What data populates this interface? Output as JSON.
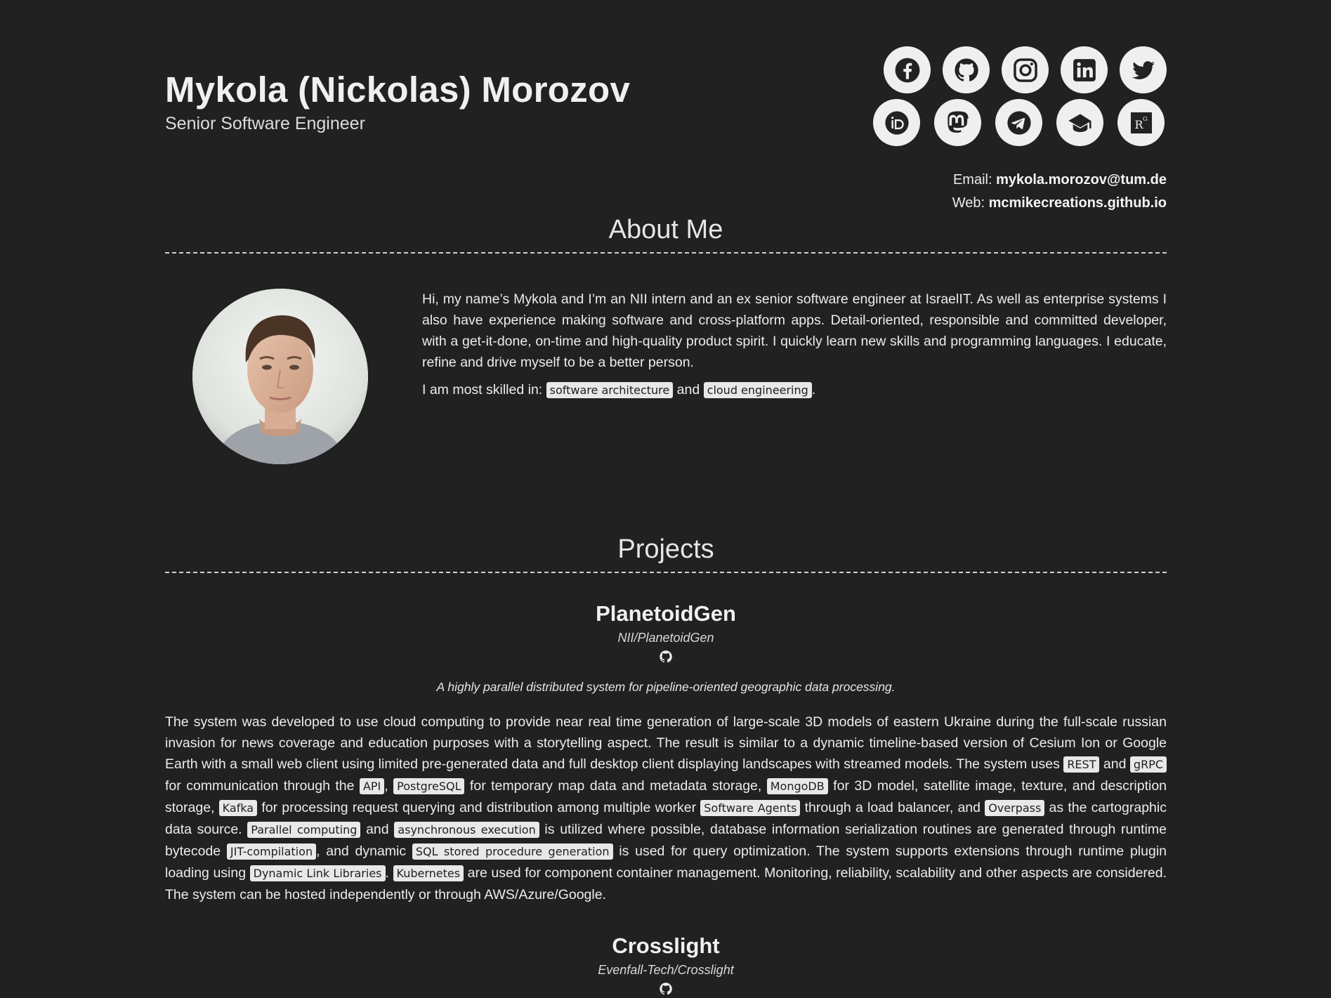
{
  "header": {
    "name": "Mykola (Nickolas) Morozov",
    "subtitle": "Senior Software Engineer",
    "socials_row1": [
      "facebook-icon",
      "github-icon",
      "instagram-icon",
      "linkedin-icon",
      "twitter-icon"
    ],
    "socials_row2": [
      "orcid-icon",
      "mastodon-icon",
      "telegram-icon",
      "scholar-icon",
      "researchgate-icon"
    ],
    "email_label": "Email:",
    "email": "mykola.morozov@tum.de",
    "web_label": "Web:",
    "web": "mcmikecreations.github.io"
  },
  "about": {
    "title": "About Me",
    "paragraph": "Hi, my name’s Mykola and I’m an NII intern and an ex senior software engineer at IsraelIT. As well as enterprise systems I also have experience making software and cross-platform apps. Detail-oriented, responsible and committed developer, with a get-it-done, on-time and high-quality product spirit. I quickly learn new skills and programming languages. I educate, refine and drive myself to be a better person.",
    "skills_intro": "I am most skilled in:",
    "skill1": "software architecture",
    "and": "and",
    "skill2": "cloud engineering",
    "period": "."
  },
  "projects": {
    "title": "Projects",
    "items": [
      {
        "name": "PlanetoidGen",
        "repo": "NII/PlanetoidGen",
        "tagline": "A highly parallel distributed system for pipeline-oriented geographic data processing.",
        "desc": {
          "t1": "The system was developed to use cloud computing to provide near real time generation of large-scale 3D models of eastern Ukraine during the full-scale russian invasion for news coverage and education purposes with a storytelling aspect. The result is similar to a dynamic timeline-based version of Cesium Ion or Google Earth with a small web client using limited pre-generated data and full desktop client displaying landscapes with streamed models. The system uses ",
          "k1": "REST",
          "t2": " and ",
          "k2": "gRPC",
          "t3": " for communication through the ",
          "k3": "API",
          "t4": ", ",
          "k4": "PostgreSQL",
          "t5": " for temporary map data and metadata storage, ",
          "k5": "MongoDB",
          "t6": " for 3D model, satellite image, texture, and description storage, ",
          "k6": "Kafka",
          "t7": " for processing request querying and distribution among multiple worker ",
          "k7": "Software Agents",
          "t8": " through a load balancer, and ",
          "k8": "Overpass",
          "t9": " as the cartographic data source. ",
          "k9": "Parallel computing",
          "t10": " and ",
          "k10": "asynchronous execution",
          "t11": " is utilized where possible, database information serialization routines are generated through runtime bytecode ",
          "k11": "JIT-compilation",
          "t12": ", and dynamic ",
          "k12": "SQL stored procedure generation",
          "t13": " is used for query optimization. The system supports extensions through runtime plugin loading using ",
          "k13": "Dynamic Link Libraries",
          "t14": ". ",
          "k14": "Kubernetes",
          "t15": " are used for component container management. Monitoring, reliability, scalability and other aspects are considered. The system can be hosted independently or through AWS/Azure/Google."
        }
      },
      {
        "name": "Crosslight",
        "repo": "Evenfall-Tech/Crosslight"
      }
    ]
  },
  "colors": {
    "background": "#212121",
    "text": "#ececec",
    "tag_bg": "#e8e8e8",
    "icon_bg": "#efefef"
  }
}
